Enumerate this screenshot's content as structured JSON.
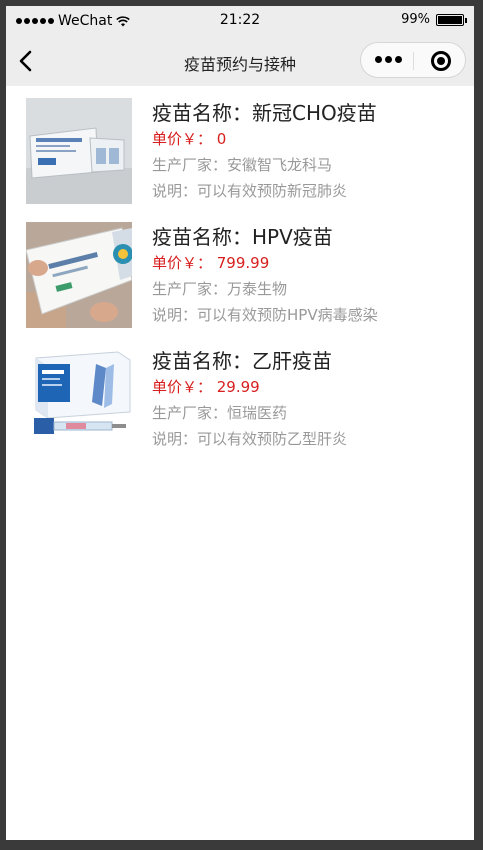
{
  "status": {
    "carrier": "WeChat",
    "time": "21:22",
    "battery": "99%",
    "battery_level": 0.99
  },
  "nav": {
    "title": "疫苗预约与接种"
  },
  "vaccines": [
    {
      "name": "疫苗名称：新冠CHO疫苗",
      "price": "单价￥：  0",
      "maker": "生产厂家：安徽智飞龙科马",
      "desc": "说明：可以有效预防新冠肺炎"
    },
    {
      "name": "疫苗名称：HPV疫苗",
      "price": "单价￥：  799.99",
      "maker": "生产厂家：万泰生物",
      "desc": "说明：可以有效预防HPV病毒感染"
    },
    {
      "name": "疫苗名称：乙肝疫苗",
      "price": "单价￥：  29.99",
      "maker": "生产厂家：恒瑞医药",
      "desc": "说明：可以有效预防乙型肝炎"
    }
  ],
  "colors": {
    "price": "#d81e1e",
    "muted": "#999999",
    "bar": "#ededed"
  }
}
